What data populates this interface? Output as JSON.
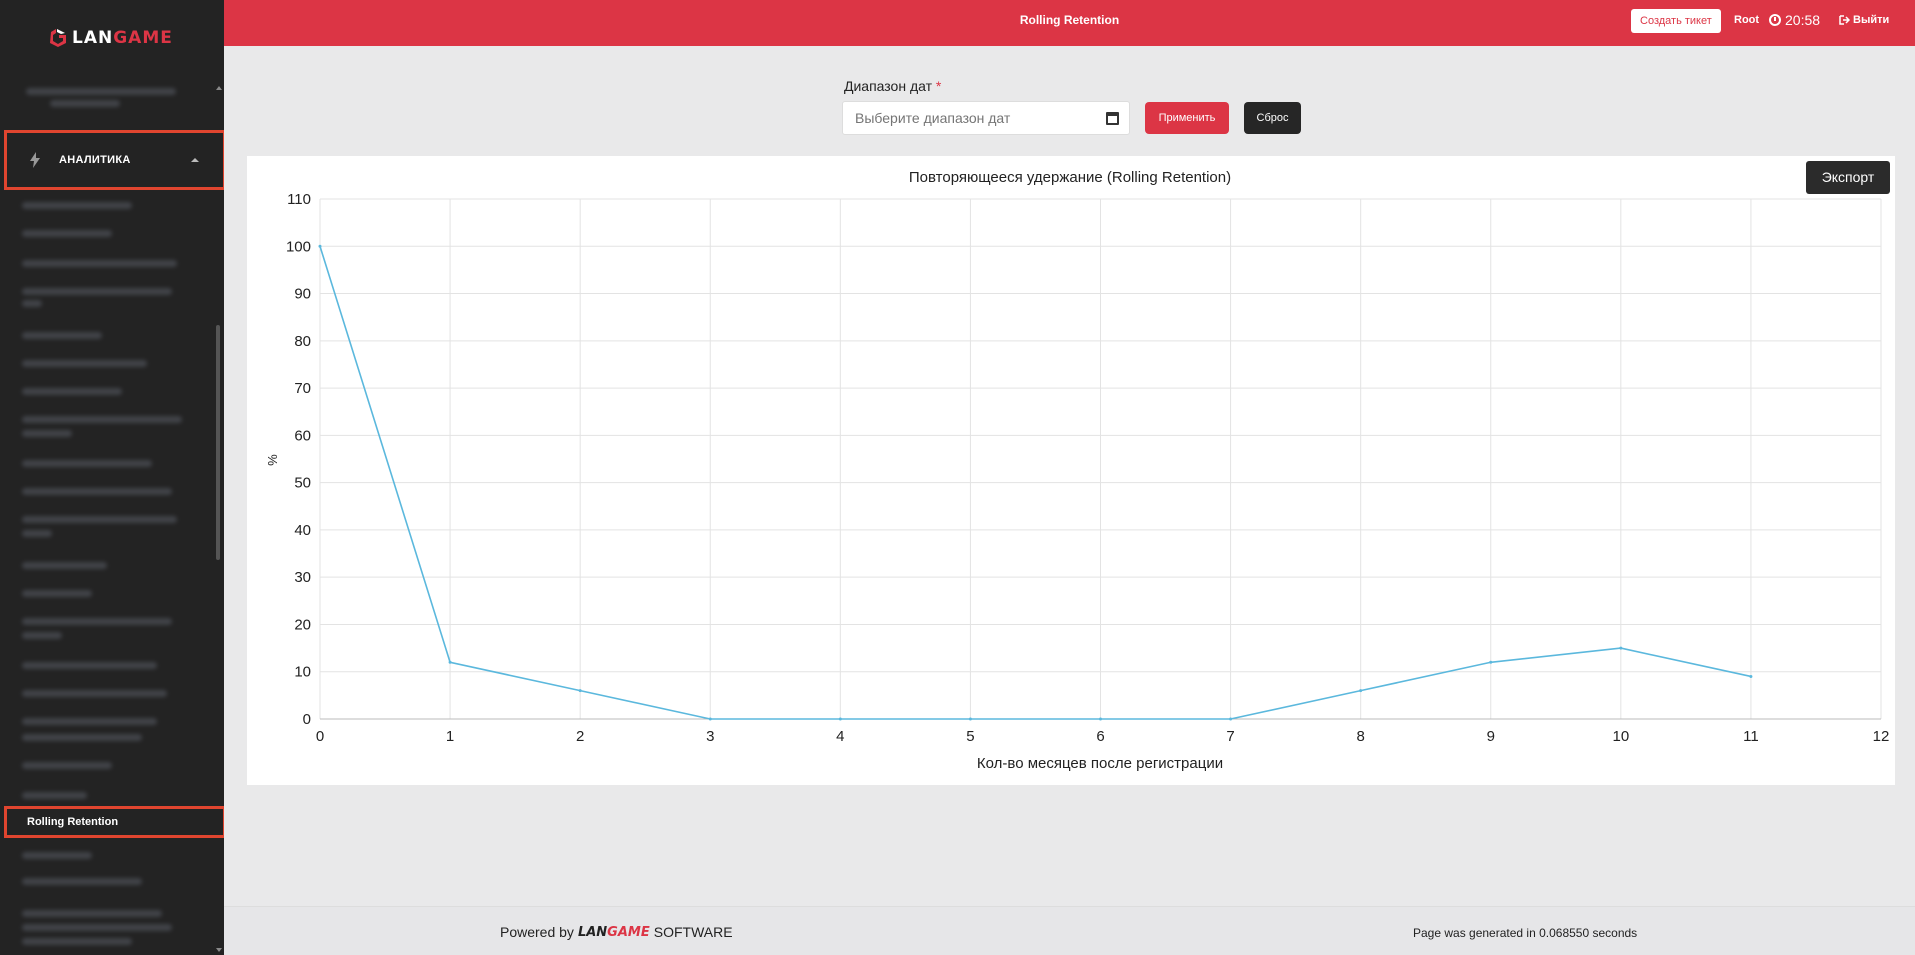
{
  "brand": {
    "part1": "LAN",
    "part2": "GAME"
  },
  "header": {
    "title": "Rolling Retention",
    "ticket_label": "Создать тикет",
    "user": "Root",
    "time": "20:58",
    "logout_label": "Выйти"
  },
  "sidebar": {
    "section_label": "АНАЛИТИКА",
    "active_item": "Rolling Retention"
  },
  "filter": {
    "label": "Диапазон дат",
    "required_mark": "*",
    "placeholder": "Выберите диапазон дат",
    "apply_label": "Применить",
    "reset_label": "Сброс"
  },
  "export_label": "Экспорт",
  "chart_data": {
    "type": "line",
    "title": "Повторяющееся удержание (Rolling Retention)",
    "xlabel": "Кол-во месяцев после регистрации",
    "ylabel": "%",
    "xlim": [
      0,
      12
    ],
    "ylim": [
      0,
      110
    ],
    "x_ticks": [
      0,
      1,
      2,
      3,
      4,
      5,
      6,
      7,
      8,
      9,
      10,
      11,
      12
    ],
    "y_ticks": [
      0,
      10,
      20,
      30,
      40,
      50,
      60,
      70,
      80,
      90,
      100,
      110
    ],
    "grid": true,
    "line_color": "#5bb8dd",
    "series": [
      {
        "x": [
          0,
          1,
          2,
          3,
          4,
          5,
          6,
          7,
          8,
          9,
          10,
          11
        ],
        "values": [
          100,
          12,
          6,
          0,
          0,
          0,
          0,
          0,
          6,
          12,
          15,
          9
        ]
      }
    ]
  },
  "footer": {
    "powered_prefix": "Powered by",
    "brand_part1": "LAN",
    "brand_part2": "GAME",
    "powered_suffix": "SOFTWARE",
    "generated": "Page was generated in 0.068550 seconds"
  },
  "colors": {
    "accent": "#dc3545",
    "sidebar_bg": "#232323",
    "highlight": "#e0452f"
  }
}
